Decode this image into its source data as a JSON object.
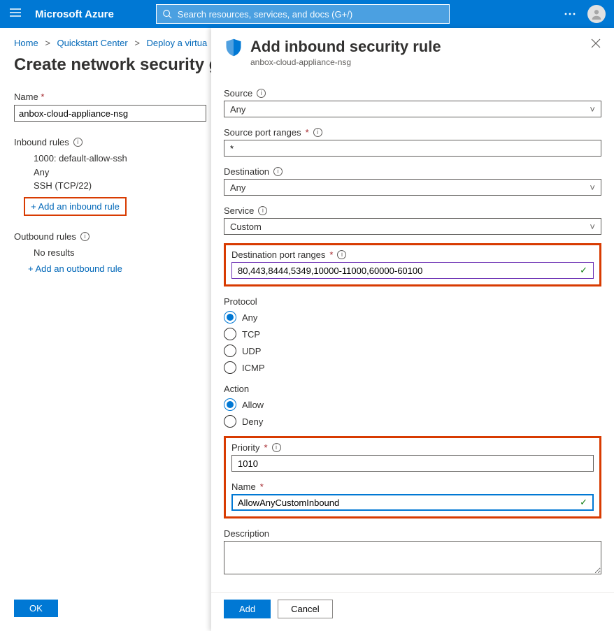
{
  "topbar": {
    "brand": "Microsoft Azure",
    "search_placeholder": "Search resources, services, and docs (G+/)"
  },
  "crumbs": {
    "home": "Home",
    "quickstart": "Quickstart Center",
    "deploy": "Deploy a virtua"
  },
  "page": {
    "title": "Create network security g"
  },
  "leftform": {
    "name_label": "Name",
    "name_value": "anbox-cloud-appliance-nsg",
    "inbound_label": "Inbound rules",
    "inbound_rules": {
      "line1": "1000: default-allow-ssh",
      "line2": "Any",
      "line3": "SSH (TCP/22)"
    },
    "add_inbound": "+ Add an inbound rule",
    "outbound_label": "Outbound rules",
    "no_results": "No results",
    "add_outbound": "+ Add an outbound rule",
    "ok": "OK"
  },
  "panel": {
    "title": "Add inbound security rule",
    "subtitle": "anbox-cloud-appliance-nsg",
    "source_label": "Source",
    "source_value": "Any",
    "source_port_label": "Source port ranges",
    "source_port_value": "*",
    "dest_label": "Destination",
    "dest_value": "Any",
    "service_label": "Service",
    "service_value": "Custom",
    "dest_port_label": "Destination port ranges",
    "dest_port_value": "80,443,8444,5349,10000-11000,60000-60100",
    "protocol_label": "Protocol",
    "protocol_options": {
      "any": "Any",
      "tcp": "TCP",
      "udp": "UDP",
      "icmp": "ICMP"
    },
    "action_label": "Action",
    "action_options": {
      "allow": "Allow",
      "deny": "Deny"
    },
    "priority_label": "Priority",
    "priority_value": "1010",
    "name_label": "Name",
    "name_value": "AllowAnyCustomInbound",
    "description_label": "Description",
    "add_btn": "Add",
    "cancel_btn": "Cancel"
  }
}
